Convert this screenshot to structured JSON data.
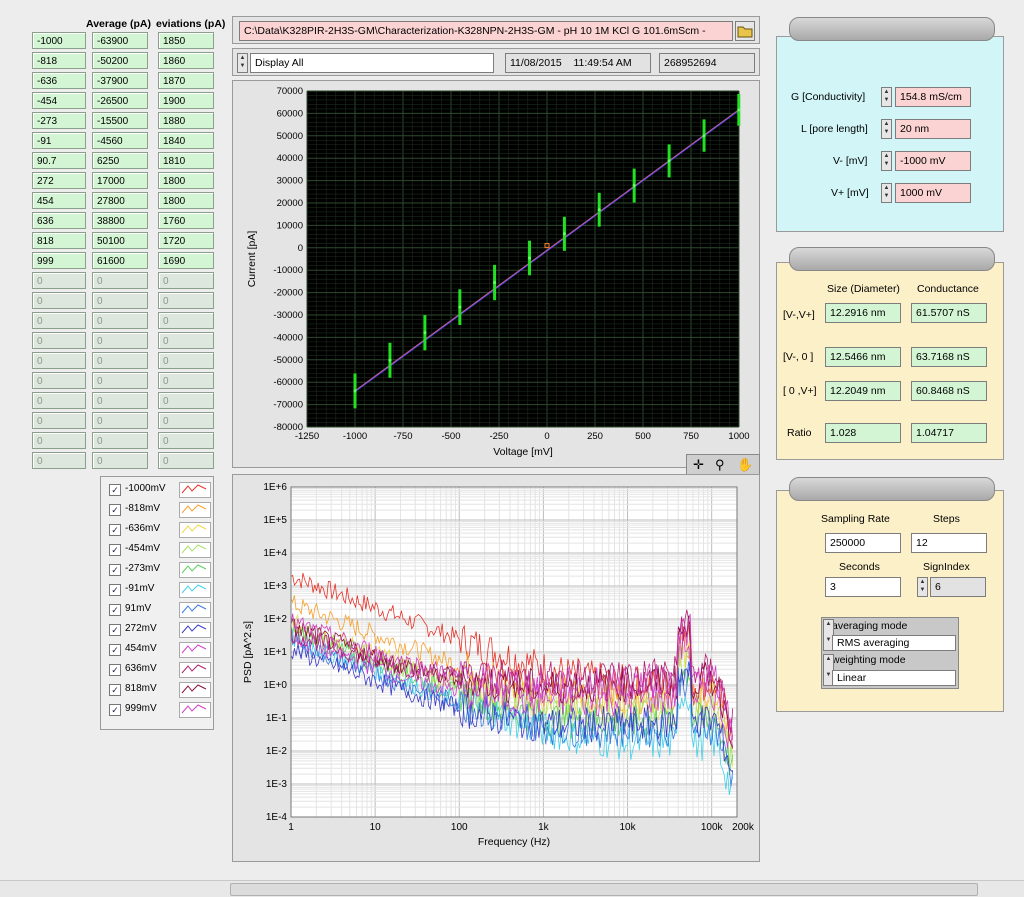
{
  "table": {
    "headers": [
      "",
      "Average (pA)",
      "eviations (pA)"
    ],
    "col1": [
      "-1000",
      "-818",
      "-636",
      "-454",
      "-273",
      "-91",
      "90.7",
      "272",
      "454",
      "636",
      "818",
      "999",
      "0",
      "0",
      "0",
      "0",
      "0",
      "0",
      "0",
      "0",
      "0",
      "0"
    ],
    "col2": [
      "-63900",
      "-50200",
      "-37900",
      "-26500",
      "-15500",
      "-4560",
      "6250",
      "17000",
      "27800",
      "38800",
      "50100",
      "61600",
      "0",
      "0",
      "0",
      "0",
      "0",
      "0",
      "0",
      "0",
      "0",
      "0"
    ],
    "col3": [
      "1850",
      "1860",
      "1870",
      "1900",
      "1880",
      "1840",
      "1810",
      "1800",
      "1800",
      "1760",
      "1720",
      "1690",
      "0",
      "0",
      "0",
      "0",
      "0",
      "0",
      "0",
      "0",
      "0",
      "0"
    ]
  },
  "legend": [
    {
      "label": "-1000mV",
      "color": "#e8332a"
    },
    {
      "label": "-818mV",
      "color": "#f5a02a"
    },
    {
      "label": "-636mV",
      "color": "#f0d84a"
    },
    {
      "label": "-454mV",
      "color": "#a8e06a"
    },
    {
      "label": "-273mV",
      "color": "#5ad05a"
    },
    {
      "label": "-91mV",
      "color": "#40d0e8"
    },
    {
      "label": "91mV",
      "color": "#3a7ae0"
    },
    {
      "label": "272mV",
      "color": "#3a3ac8"
    },
    {
      "label": "454mV",
      "color": "#d040d0"
    },
    {
      "label": "636mV",
      "color": "#b02070"
    },
    {
      "label": "818mV",
      "color": "#8a1040"
    },
    {
      "label": "999mV",
      "color": "#d040c0"
    }
  ],
  "path": "C:\\Data\\K328PIR-2H3S-GM\\Characterization-K328NPN-2H3S-GM - pH 10 1M KCl G 101.6mScm -",
  "display_mode": "Display All",
  "date": "11/08/2015",
  "time": "11:49:54 AM",
  "counter": "268952694",
  "params": {
    "g_label": "G [Conductivity]",
    "g_value": "154.8 mS/cm",
    "l_label": "L [pore length]",
    "l_value": "20 nm",
    "vm_label": "V- [mV]",
    "vm_value": "-1000 mV",
    "vp_label": "V+ [mV]",
    "vp_value": "1000 mV"
  },
  "results": {
    "size_header": "Size (Diameter)",
    "cond_header": "Conductance",
    "rows": [
      {
        "label": "[V-,V+]",
        "size": "12.2916 nm",
        "cond": "61.5707 nS"
      },
      {
        "label": "[V-, 0 ]",
        "size": "12.5466 nm",
        "cond": "63.7168 nS"
      },
      {
        "label": "[ 0 ,V+]",
        "size": "12.2049 nm",
        "cond": "60.8468 nS"
      }
    ],
    "ratio_label": "Ratio",
    "ratio_size": "1.028",
    "ratio_cond": "1.04717"
  },
  "sampling": {
    "rate_label": "Sampling Rate",
    "rate_value": "250000",
    "steps_label": "Steps",
    "steps_value": "12",
    "seconds_label": "Seconds",
    "seconds_value": "3",
    "sign_label": "SignIndex",
    "sign_value": "6",
    "avg_mode_label": "averaging mode",
    "avg_mode_value": "RMS averaging",
    "weight_label": "weighting mode",
    "weight_value": "Linear"
  },
  "chart_data": [
    {
      "type": "scatter",
      "title": "",
      "xlabel": "Voltage [mV]",
      "ylabel": "Current [pA]",
      "xlim": [
        -1250,
        1000
      ],
      "ylim": [
        -80000,
        70000
      ],
      "xticks": [
        "-1250",
        "-1000",
        "-750",
        "-500",
        "-250",
        "0",
        "250",
        "500",
        "750",
        "1000"
      ],
      "yticks": [
        "70000",
        "60000",
        "50000",
        "40000",
        "30000",
        "20000",
        "10000",
        "0",
        "-10000",
        "-20000",
        "-30000",
        "-40000",
        "-50000",
        "-60000",
        "-70000",
        "-80000"
      ],
      "x": [
        -1000,
        -818,
        -636,
        -454,
        -273,
        -91,
        90.7,
        272,
        454,
        636,
        818,
        999
      ],
      "y": [
        -63900,
        -50200,
        -37900,
        -26500,
        -15500,
        -4560,
        6250,
        17000,
        27800,
        38800,
        50100,
        61600
      ],
      "err": [
        1850,
        1860,
        1870,
        1900,
        1880,
        1840,
        1810,
        1800,
        1800,
        1760,
        1720,
        1690
      ],
      "grid": true
    },
    {
      "type": "line",
      "title": "",
      "xlabel": "Frequency (Hz)",
      "ylabel": "PSD [pA^2.s]",
      "xscale": "log",
      "yscale": "log",
      "xlim": [
        1,
        200000
      ],
      "ylim": [
        0.0001,
        1000000
      ],
      "xticks": [
        "1",
        "10",
        "100",
        "1k",
        "10k",
        "100k",
        "200k"
      ],
      "yticks": [
        "1E+6",
        "1E+5",
        "1E+4",
        "1E+3",
        "1E+2",
        "1E+1",
        "1E+0",
        "1E-1",
        "1E-2",
        "1E-3",
        "1E-4"
      ],
      "grid": true
    }
  ]
}
